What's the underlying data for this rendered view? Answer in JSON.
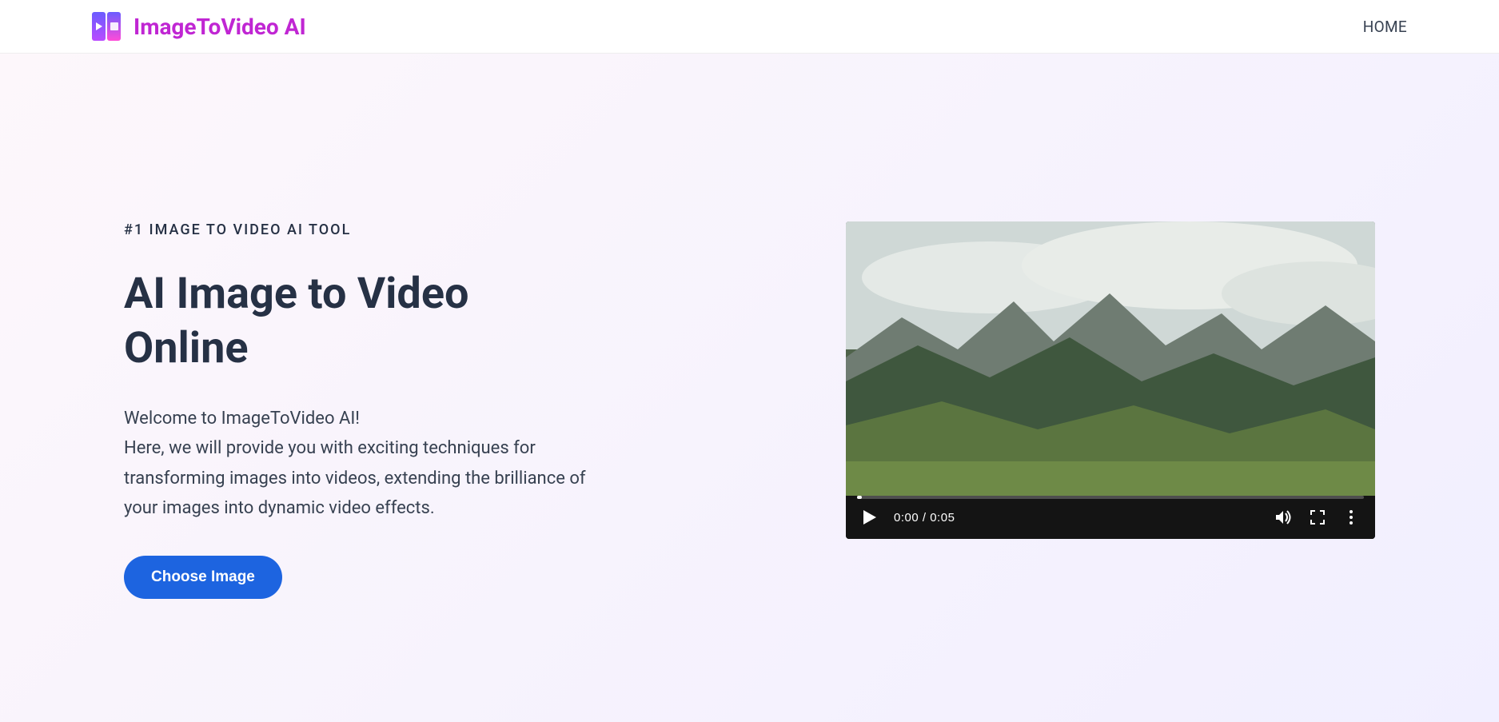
{
  "header": {
    "brand_name": "ImageToVideo AI",
    "nav_home": "HOME"
  },
  "hero": {
    "tagline": "#1 IMAGE TO VIDEO AI TOOL",
    "title": "AI Image to Video Online",
    "welcome": "Welcome to ImageToVideo AI!",
    "description": "Here, we will provide you with exciting techniques for transforming images into videos, extending the brilliance of your images into dynamic video effects.",
    "cta": "Choose Image"
  },
  "video": {
    "current_time": "0:00",
    "duration": "0:05"
  }
}
